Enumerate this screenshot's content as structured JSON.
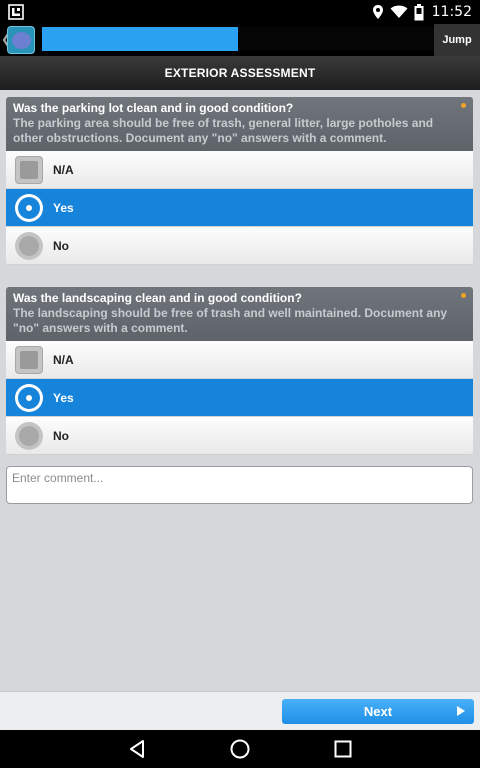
{
  "status_bar": {
    "time": "11:52",
    "icons": [
      "notification-icon",
      "location-icon",
      "wifi-icon",
      "battery-icon"
    ]
  },
  "app_header": {
    "back_icon": "chevron-left-icon",
    "logo_icon": "app-logo-icon",
    "progress_fraction": 0.5,
    "jump_label": "Jump",
    "progress_color": "#2aa2f1"
  },
  "section": {
    "title": "EXTERIOR ASSESSMENT"
  },
  "questions": [
    {
      "title": "Was the parking lot clean and in good condition?",
      "description": "The parking area should be free of trash, general litter, large potholes and other obstructions. Document any \"no\" answers with a comment.",
      "options": [
        {
          "label": "N/A",
          "type": "checkbox",
          "selected": false
        },
        {
          "label": "Yes",
          "type": "radio",
          "selected": true
        },
        {
          "label": "No",
          "type": "radio",
          "selected": false
        }
      ]
    },
    {
      "title": "Was the landscaping clean and in good condition?",
      "description": "The landscaping should be free of trash and well maintained. Document any \"no\" answers with a comment.",
      "options": [
        {
          "label": "N/A",
          "type": "checkbox",
          "selected": false
        },
        {
          "label": "Yes",
          "type": "radio",
          "selected": true
        },
        {
          "label": "No",
          "type": "radio",
          "selected": false
        }
      ]
    }
  ],
  "comment": {
    "placeholder": "Enter comment...",
    "value": ""
  },
  "footer": {
    "next_label": "Next"
  },
  "nav_bar": {
    "icons": [
      "back-icon",
      "home-icon",
      "recents-icon"
    ]
  },
  "colors": {
    "accent": "#1784dc",
    "required_dot": "#f0a22a"
  }
}
